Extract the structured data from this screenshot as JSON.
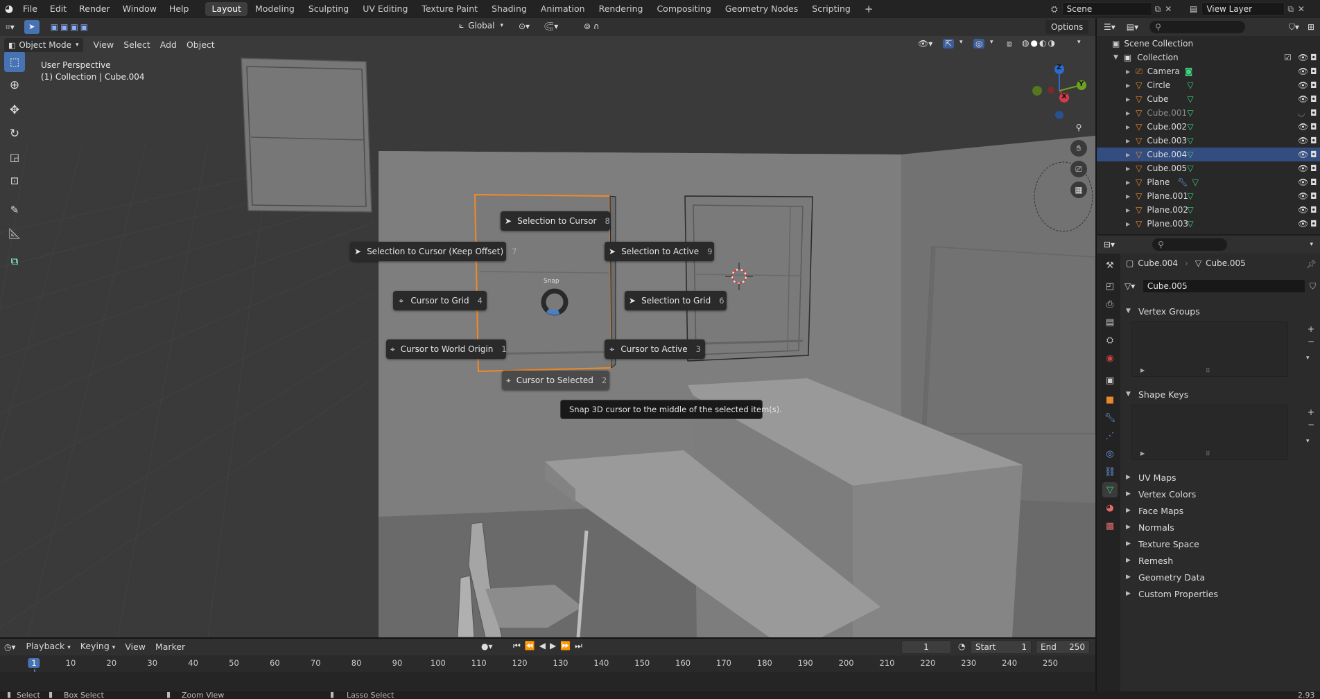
{
  "topbar": {
    "menus": [
      "File",
      "Edit",
      "Render",
      "Window",
      "Help"
    ],
    "workspaces": [
      "Layout",
      "Modeling",
      "Sculpting",
      "UV Editing",
      "Texture Paint",
      "Shading",
      "Animation",
      "Rendering",
      "Compositing",
      "Geometry Nodes",
      "Scripting"
    ],
    "active_workspace": "Layout",
    "add_tab": "+",
    "scene_name": "Scene",
    "view_layer": "View Layer"
  },
  "tool_header": {
    "transform_orientation": "Global",
    "options_label": "Options"
  },
  "viewport_header": {
    "mode": "Object Mode",
    "menus": [
      "View",
      "Select",
      "Add",
      "Object"
    ]
  },
  "viewport": {
    "perspective_label": "User Perspective",
    "collection_label": "(1) Collection | Cube.004",
    "gizmo_axes": {
      "z": "Z",
      "y": "Y",
      "x": "X"
    }
  },
  "pie_menu": {
    "center_label": "Snap",
    "items": [
      {
        "label": "Selection to Cursor",
        "key": "8",
        "icon": "cursor-arrow-icon"
      },
      {
        "label": "Selection to Cursor (Keep Offset)",
        "key": "7",
        "icon": "cursor-arrow-icon"
      },
      {
        "label": "Selection to Active",
        "key": "9",
        "icon": "cursor-arrow-icon"
      },
      {
        "label": "Cursor to Grid",
        "key": "4",
        "icon": "crosshair-icon"
      },
      {
        "label": "Selection to Grid",
        "key": "6",
        "icon": "cursor-arrow-icon"
      },
      {
        "label": "Cursor to World Origin",
        "key": "1",
        "icon": "crosshair-icon"
      },
      {
        "label": "Cursor to Active",
        "key": "3",
        "icon": "crosshair-icon"
      },
      {
        "label": "Cursor to Selected",
        "key": "2",
        "icon": "crosshair-icon"
      }
    ],
    "tooltip": "Snap 3D cursor to the middle of the selected item(s)."
  },
  "outliner": {
    "scene_collection": "Scene Collection",
    "collection": "Collection",
    "items": [
      {
        "name": "Camera",
        "selected": false,
        "dim": false
      },
      {
        "name": "Circle",
        "selected": false,
        "dim": false
      },
      {
        "name": "Cube",
        "selected": false,
        "dim": false
      },
      {
        "name": "Cube.001",
        "selected": false,
        "dim": true
      },
      {
        "name": "Cube.002",
        "selected": false,
        "dim": false
      },
      {
        "name": "Cube.003",
        "selected": false,
        "dim": false
      },
      {
        "name": "Cube.004",
        "selected": true,
        "dim": false
      },
      {
        "name": "Cube.005",
        "selected": false,
        "dim": false
      },
      {
        "name": "Plane",
        "selected": false,
        "dim": false
      },
      {
        "name": "Plane.001",
        "selected": false,
        "dim": false
      },
      {
        "name": "Plane.002",
        "selected": false,
        "dim": false
      },
      {
        "name": "Plane.003",
        "selected": false,
        "dim": false
      }
    ]
  },
  "properties": {
    "breadcrumb_object": "Cube.004",
    "breadcrumb_mesh": "Cube.005",
    "mesh_name": "Cube.005",
    "open_panels": [
      "Vertex Groups",
      "Shape Keys"
    ],
    "closed_panels": [
      "UV Maps",
      "Vertex Colors",
      "Face Maps",
      "Normals",
      "Texture Space",
      "Remesh",
      "Geometry Data",
      "Custom Properties"
    ]
  },
  "timeline": {
    "menus": [
      "Playback",
      "Keying",
      "View",
      "Marker"
    ],
    "current_frame": "1",
    "start_label": "Start",
    "start_value": "1",
    "end_label": "End",
    "end_value": "250",
    "ticks": [
      "1",
      "10",
      "20",
      "30",
      "40",
      "50",
      "60",
      "70",
      "80",
      "90",
      "100",
      "110",
      "120",
      "130",
      "140",
      "150",
      "160",
      "170",
      "180",
      "190",
      "200",
      "210",
      "220",
      "230",
      "240",
      "250"
    ]
  },
  "statusbar": {
    "items": [
      "Select",
      "Box Select",
      "Zoom View",
      "Lasso Select"
    ],
    "version": "2.93"
  }
}
